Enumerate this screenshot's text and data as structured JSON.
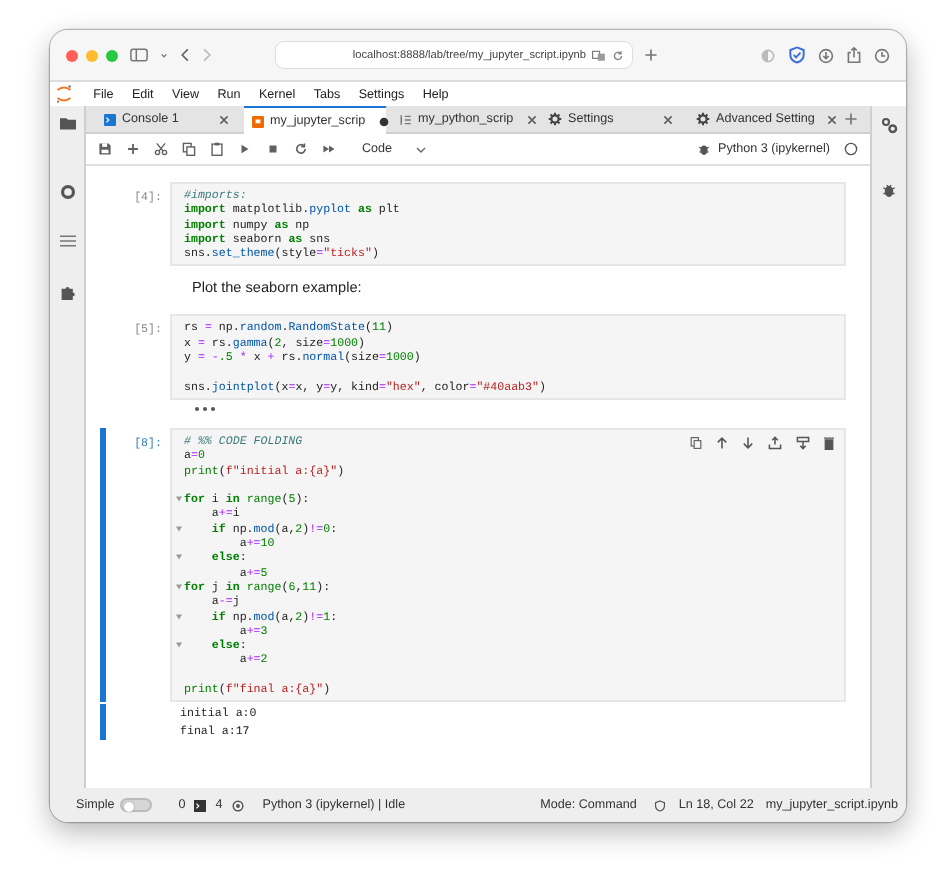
{
  "browser": {
    "url": "localhost:8888/lab/tree/my_jupyter_script.ipynb"
  },
  "menu": [
    "File",
    "Edit",
    "View",
    "Run",
    "Kernel",
    "Tabs",
    "Settings",
    "Help"
  ],
  "tabs": [
    {
      "label": "Console 1",
      "kind": "console",
      "selected": false,
      "modified": false
    },
    {
      "label": "my_jupyter_scrip",
      "kind": "notebook",
      "selected": true,
      "modified": true
    },
    {
      "label": "my_python_scrip",
      "kind": "script",
      "selected": false,
      "modified": false
    },
    {
      "label": "Settings",
      "kind": "settings",
      "selected": false,
      "modified": false
    },
    {
      "label": "Advanced Setting",
      "kind": "settings",
      "selected": false,
      "modified": false
    }
  ],
  "notebook_toolbar": {
    "cell_type": "Code",
    "kernel": "Python 3 (ipykernel)"
  },
  "cells": [
    {
      "kind": "code",
      "prompt": "[4]:",
      "active": false,
      "lines": [
        {
          "tokens": [
            {
              "text": "#imports:",
              "kind": "comment"
            }
          ]
        },
        {
          "tokens": [
            {
              "text": "import",
              "kind": "keyword"
            },
            {
              "text": " matplotlib.",
              "kind": "text"
            },
            {
              "text": "pyplot",
              "kind": "attribute"
            },
            {
              "text": " as",
              "kind": "keyword"
            },
            {
              "text": " plt",
              "kind": "text"
            }
          ]
        },
        {
          "tokens": [
            {
              "text": "import",
              "kind": "keyword"
            },
            {
              "text": " numpy ",
              "kind": "text"
            },
            {
              "text": "as",
              "kind": "keyword"
            },
            {
              "text": " np",
              "kind": "text"
            }
          ]
        },
        {
          "tokens": [
            {
              "text": "import",
              "kind": "keyword"
            },
            {
              "text": " seaborn ",
              "kind": "text"
            },
            {
              "text": "as",
              "kind": "keyword"
            },
            {
              "text": " sns",
              "kind": "text"
            }
          ]
        },
        {
          "tokens": [
            {
              "text": "sns.",
              "kind": "text"
            },
            {
              "text": "set_theme",
              "kind": "attribute"
            },
            {
              "text": "(style",
              "kind": "text"
            },
            {
              "text": "=",
              "kind": "operator"
            },
            {
              "text": "\"ticks\"",
              "kind": "string"
            },
            {
              "text": ")",
              "kind": "text"
            }
          ]
        }
      ]
    },
    {
      "kind": "markdown",
      "text": "Plot the seaborn example:"
    },
    {
      "kind": "code",
      "prompt": "[5]:",
      "active": false,
      "output_collapsed": true,
      "lines": [
        {
          "tokens": [
            {
              "text": "rs ",
              "kind": "text"
            },
            {
              "text": "=",
              "kind": "operator"
            },
            {
              "text": " np.",
              "kind": "text"
            },
            {
              "text": "random",
              "kind": "attribute"
            },
            {
              "text": ".",
              "kind": "text"
            },
            {
              "text": "RandomState",
              "kind": "attribute"
            },
            {
              "text": "(",
              "kind": "text"
            },
            {
              "text": "11",
              "kind": "number"
            },
            {
              "text": ")",
              "kind": "text"
            }
          ]
        },
        {
          "tokens": [
            {
              "text": "x ",
              "kind": "text"
            },
            {
              "text": "=",
              "kind": "operator"
            },
            {
              "text": " rs.",
              "kind": "text"
            },
            {
              "text": "gamma",
              "kind": "attribute"
            },
            {
              "text": "(",
              "kind": "text"
            },
            {
              "text": "2",
              "kind": "number"
            },
            {
              "text": ", size",
              "kind": "text"
            },
            {
              "text": "=",
              "kind": "operator"
            },
            {
              "text": "1000",
              "kind": "number"
            },
            {
              "text": ")",
              "kind": "text"
            }
          ]
        },
        {
          "tokens": [
            {
              "text": "y ",
              "kind": "text"
            },
            {
              "text": "=",
              "kind": "operator"
            },
            {
              "text": " -",
              "kind": "operator"
            },
            {
              "text": ".5",
              "kind": "number"
            },
            {
              "text": " *",
              "kind": "operator"
            },
            {
              "text": " x ",
              "kind": "text"
            },
            {
              "text": "+",
              "kind": "operator"
            },
            {
              "text": " rs.",
              "kind": "text"
            },
            {
              "text": "normal",
              "kind": "attribute"
            },
            {
              "text": "(size",
              "kind": "text"
            },
            {
              "text": "=",
              "kind": "operator"
            },
            {
              "text": "1000",
              "kind": "number"
            },
            {
              "text": ")",
              "kind": "text"
            }
          ]
        },
        {
          "blank_before": true,
          "tokens": [
            {
              "text": "sns.",
              "kind": "text"
            },
            {
              "text": "jointplot",
              "kind": "attribute"
            },
            {
              "text": "(x",
              "kind": "text"
            },
            {
              "text": "=",
              "kind": "operator"
            },
            {
              "text": "x, y",
              "kind": "text"
            },
            {
              "text": "=",
              "kind": "operator"
            },
            {
              "text": "y, kind",
              "kind": "text"
            },
            {
              "text": "=",
              "kind": "operator"
            },
            {
              "text": "\"hex\"",
              "kind": "string"
            },
            {
              "text": ", color",
              "kind": "text"
            },
            {
              "text": "=",
              "kind": "operator"
            },
            {
              "text": "\"#40aab3\"",
              "kind": "string"
            },
            {
              "text": ")",
              "kind": "text"
            }
          ]
        }
      ]
    },
    {
      "kind": "code",
      "prompt": "[8]:",
      "active": true,
      "lines": [
        {
          "foldable": false,
          "tokens": [
            {
              "text": "# %% CODE FOLDING",
              "kind": "comment"
            }
          ]
        },
        {
          "foldable": false,
          "tokens": [
            {
              "text": "a",
              "kind": "text"
            },
            {
              "text": "=",
              "kind": "operator"
            },
            {
              "text": "0",
              "kind": "number"
            }
          ]
        },
        {
          "foldable": false,
          "tokens": [
            {
              "text": "print",
              "kind": "builtin"
            },
            {
              "text": "(",
              "kind": "text"
            },
            {
              "text": "f\"initial a:{a}\"",
              "kind": "string"
            },
            {
              "text": ")",
              "kind": "text"
            }
          ]
        },
        {
          "foldable": true,
          "blank_before": true,
          "tokens": [
            {
              "text": "for",
              "kind": "keyword"
            },
            {
              "text": " i ",
              "kind": "text"
            },
            {
              "text": "in",
              "kind": "keyword"
            },
            {
              "text": " range",
              "kind": "builtin"
            },
            {
              "text": "(",
              "kind": "text"
            },
            {
              "text": "5",
              "kind": "number"
            },
            {
              "text": "):",
              "kind": "text"
            }
          ]
        },
        {
          "foldable": false,
          "tokens": [
            {
              "text": "    a",
              "kind": "text"
            },
            {
              "text": "+=",
              "kind": "operator"
            },
            {
              "text": "i",
              "kind": "text"
            }
          ]
        },
        {
          "foldable": true,
          "tokens": [
            {
              "text": "    if",
              "kind": "keyword"
            },
            {
              "text": " np.",
              "kind": "text"
            },
            {
              "text": "mod",
              "kind": "attribute"
            },
            {
              "text": "(a,",
              "kind": "text"
            },
            {
              "text": "2",
              "kind": "number"
            },
            {
              "text": ")",
              "kind": "text"
            },
            {
              "text": "!=",
              "kind": "operator"
            },
            {
              "text": "0",
              "kind": "number"
            },
            {
              "text": ":",
              "kind": "text"
            }
          ]
        },
        {
          "foldable": false,
          "tokens": [
            {
              "text": "        a",
              "kind": "text"
            },
            {
              "text": "+=",
              "kind": "operator"
            },
            {
              "text": "10",
              "kind": "number"
            }
          ]
        },
        {
          "foldable": true,
          "tokens": [
            {
              "text": "    else",
              "kind": "keyword"
            },
            {
              "text": ":",
              "kind": "text"
            }
          ]
        },
        {
          "foldable": false,
          "tokens": [
            {
              "text": "        a",
              "kind": "text"
            },
            {
              "text": "+=",
              "kind": "operator"
            },
            {
              "text": "5",
              "kind": "number"
            }
          ]
        },
        {
          "foldable": true,
          "tokens": [
            {
              "text": "for",
              "kind": "keyword"
            },
            {
              "text": " j ",
              "kind": "text"
            },
            {
              "text": "in",
              "kind": "keyword"
            },
            {
              "text": " range",
              "kind": "builtin"
            },
            {
              "text": "(",
              "kind": "text"
            },
            {
              "text": "6",
              "kind": "number"
            },
            {
              "text": ",",
              "kind": "text"
            },
            {
              "text": "11",
              "kind": "number"
            },
            {
              "text": "):",
              "kind": "text"
            }
          ]
        },
        {
          "foldable": false,
          "tokens": [
            {
              "text": "    a",
              "kind": "text"
            },
            {
              "text": "-=",
              "kind": "operator"
            },
            {
              "text": "j",
              "kind": "text"
            }
          ]
        },
        {
          "foldable": true,
          "tokens": [
            {
              "text": "    if",
              "kind": "keyword"
            },
            {
              "text": " np.",
              "kind": "text"
            },
            {
              "text": "mod",
              "kind": "attribute"
            },
            {
              "text": "(a,",
              "kind": "text"
            },
            {
              "text": "2",
              "kind": "number"
            },
            {
              "text": ")",
              "kind": "text"
            },
            {
              "text": "!=",
              "kind": "operator"
            },
            {
              "text": "1",
              "kind": "number"
            },
            {
              "text": ":",
              "kind": "text"
            }
          ]
        },
        {
          "foldable": false,
          "tokens": [
            {
              "text": "        a",
              "kind": "text"
            },
            {
              "text": "+=",
              "kind": "operator"
            },
            {
              "text": "3",
              "kind": "number"
            }
          ]
        },
        {
          "foldable": true,
          "tokens": [
            {
              "text": "    else",
              "kind": "keyword"
            },
            {
              "text": ":",
              "kind": "text"
            }
          ]
        },
        {
          "foldable": false,
          "tokens": [
            {
              "text": "        a",
              "kind": "text"
            },
            {
              "text": "+=",
              "kind": "operator"
            },
            {
              "text": "2",
              "kind": "number"
            }
          ]
        },
        {
          "foldable": false,
          "blank_before": true,
          "tokens": [
            {
              "text": "print",
              "kind": "builtin"
            },
            {
              "text": "(",
              "kind": "text"
            },
            {
              "text": "f\"final a:{a}\"",
              "kind": "string"
            },
            {
              "text": ")",
              "kind": "text"
            }
          ]
        }
      ],
      "output": [
        "initial a:0",
        "final a:17"
      ]
    }
  ],
  "status_bar": {
    "mode_label": "Simple",
    "simple_on": false,
    "terminals": "0",
    "kernels": "4",
    "kernel_status": "Python 3 (ipykernel) | Idle",
    "mode": "Mode: Command",
    "position": "Ln 18, Col 22",
    "file": "my_jupyter_script.ipynb"
  }
}
